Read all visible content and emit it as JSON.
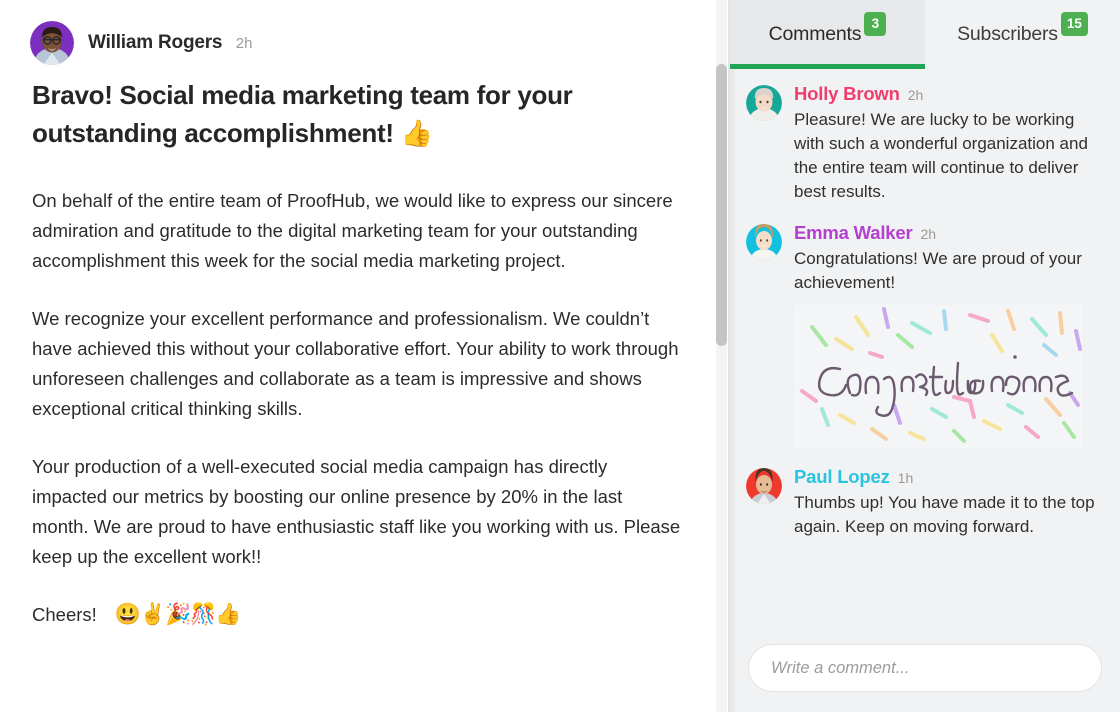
{
  "post": {
    "author": "William Rogers",
    "time": "2h",
    "avatar_bg": "#7b2fbe",
    "title_text": "Bravo! Social media marketing team for your outstanding accomplishment!",
    "title_emoji": "👍",
    "paragraphs": [
      "On behalf of the entire team of ProofHub, we would like to express our sincere admiration and gratitude to the digital marketing team for your outstanding accomplishment this week for the social media marketing project.",
      "We recognize your excellent performance and professionalism. We couldn’t have achieved this without your collaborative effort. Your ability to work through unforeseen challenges and collaborate as a team is impressive and shows exceptional critical thinking skills.",
      "Your production of a well-executed social media campaign has directly impacted our metrics by boosting our online presence by 20% in the last month. We are proud to have enthusiastic staff like you working with us. Please keep up the excellent work!!"
    ],
    "cheers_label": "Cheers!",
    "cheers_emojis": "😃✌️🎉🎊👍"
  },
  "side_panel": {
    "tabs": [
      {
        "label": "Comments",
        "badge": "3",
        "active": true
      },
      {
        "label": "Subscribers",
        "badge": "15",
        "active": false
      }
    ],
    "badge_color": "#4cb050",
    "active_underline_color": "#1fa553",
    "comments": [
      {
        "name": "Holly Brown",
        "name_color": "#ef3e6d",
        "time": "2h",
        "avatar_bg": "#16a79a",
        "text": "Pleasure! We are lucky to be working with such a wonderful organization and the entire team will continue to deliver best results.",
        "attachment": null
      },
      {
        "name": "Emma Walker",
        "name_color": "#b43fd0",
        "time": "2h",
        "avatar_bg": "#12c0e0",
        "text": "Congratulations! We are proud of your achievement!",
        "attachment": {
          "type": "image",
          "alt": "Congratulations",
          "word": "Congratulations"
        }
      },
      {
        "name": "Paul Lopez",
        "name_color": "#29c4e0",
        "time": "1h",
        "avatar_bg": "#f0392e",
        "text": "Thumbs up! You have made it to the top again. Keep on moving forward.",
        "attachment": null
      }
    ],
    "composer": {
      "placeholder": "Write a comment...",
      "value": ""
    }
  }
}
